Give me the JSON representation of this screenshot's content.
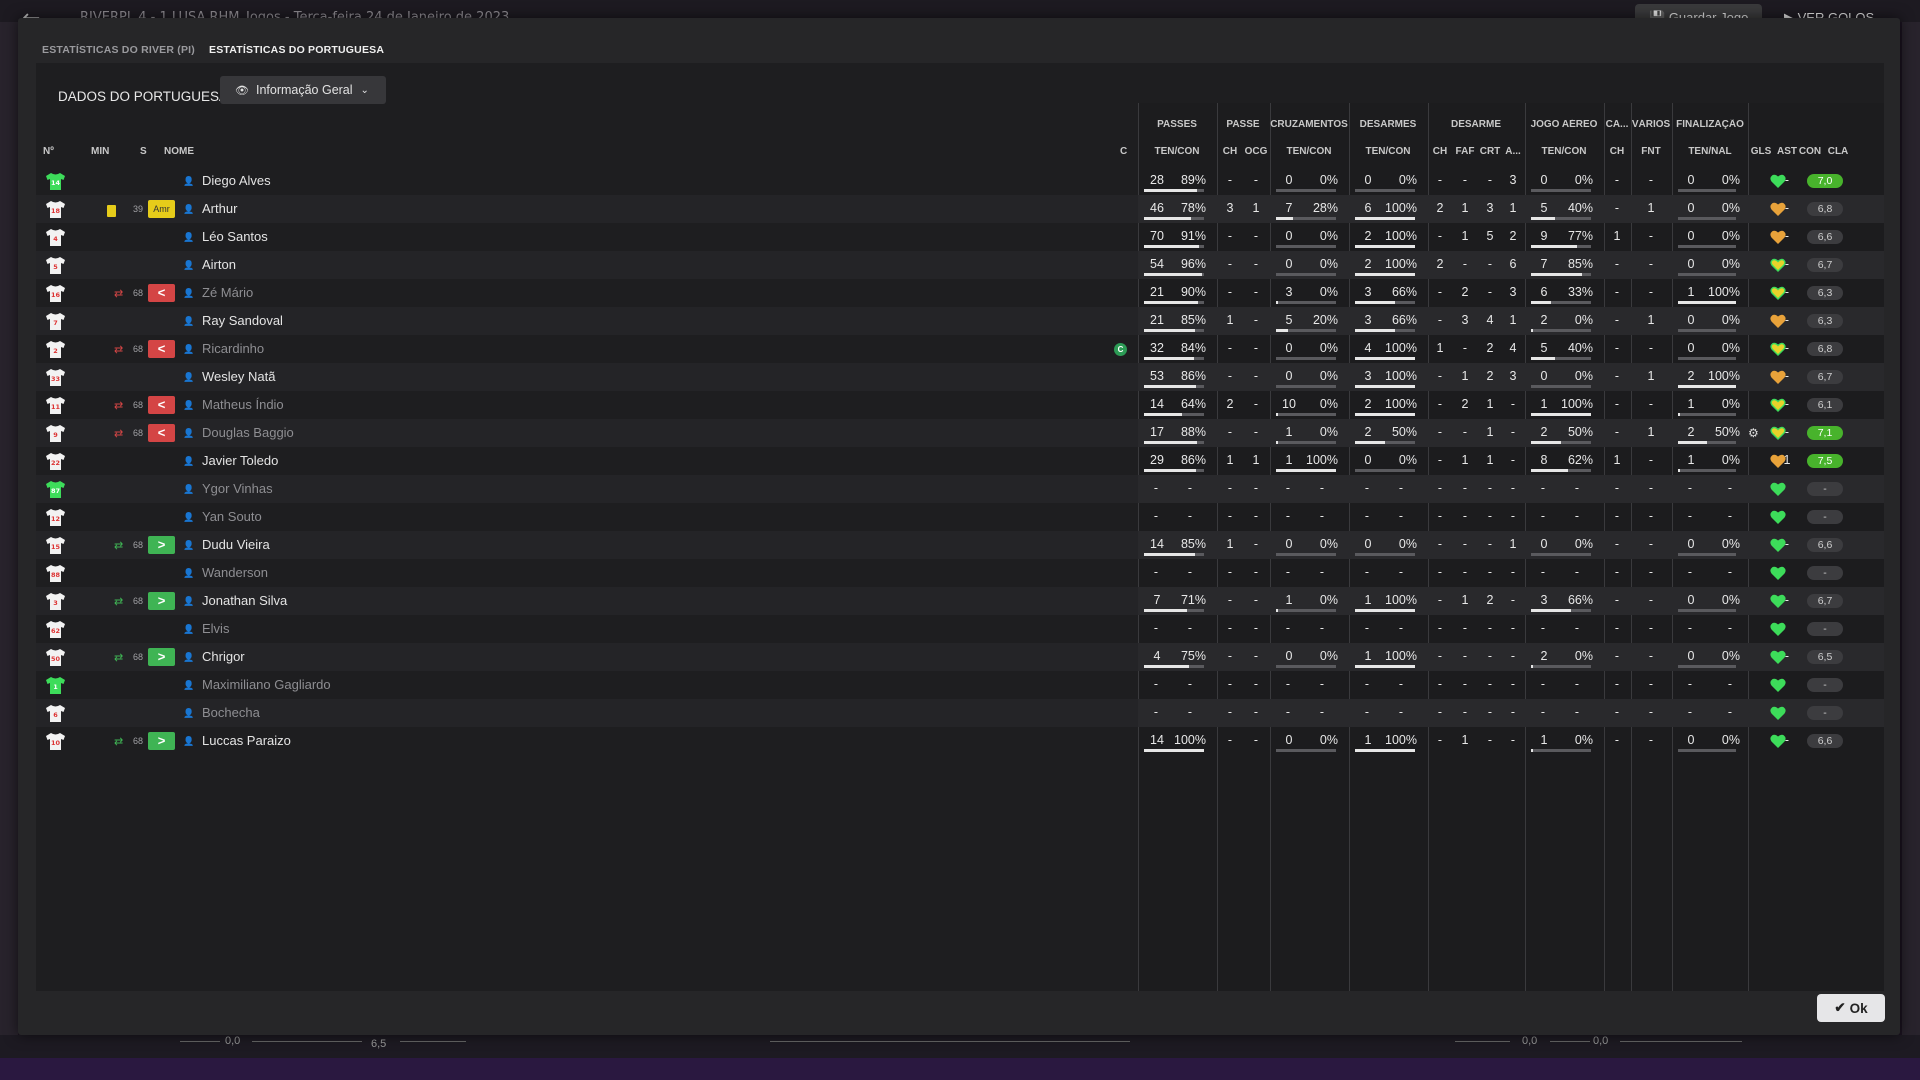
{
  "background": {
    "header_text": "RIVERPL  4 - 1  LUSA   RHM_Jogos  -  Terça-feira 24 de Janeiro de 2023",
    "save_button": "Guardar Jogo",
    "goals_button": "VER GOLOS",
    "bottom_value": "6,5",
    "bottom_left_value": "0,0",
    "bottom_right_value_1": "0,0",
    "bottom_right_value_2": "0,0"
  },
  "tabs": [
    "ESTATÍSTICAS DO RIVER (PI)",
    "ESTATÍSTICAS DO PORTUGUESA"
  ],
  "active_tab": 1,
  "panel_title": "DADOS DO PORTUGUESA",
  "view_select": "Informação Geral",
  "groups": {
    "passes": "PASSES",
    "passe": "PASSE",
    "cruzamentos": "CRUZAMENTOS",
    "desarmes": "DESARMES",
    "desarme": "DESARME",
    "jogo_aereo": "JOGO AÉREO",
    "ca": "CA...",
    "varios": "VÁRIOS",
    "finalizacao": "FINALIZAÇÃO"
  },
  "columns": {
    "no": "Nº",
    "min": "MIN",
    "s": "S",
    "nome": "NOME",
    "c": "C",
    "passes_tc": "TEN/CON",
    "passe_ch": "CH",
    "passe_ocg": "OCG",
    "cruz_tc": "TEN/CON",
    "des_tc": "TEN/CON",
    "d_ch": "CH",
    "d_faf": "FAF",
    "d_crt": "CRT",
    "d_a": "A...",
    "ja_tc": "TEN/CON",
    "ca_ch": "CH",
    "var_fnt": "FNT",
    "fin_tn": "TEN/NAL",
    "gls": "GLS",
    "ast": "AST",
    "con": "CON",
    "cla": "CLA"
  },
  "colors": {
    "heart_green": "#3ddc5a",
    "heart_yellow": "#e8d22a",
    "heart_orange": "#e8a23a",
    "rating_high": "#48b32c",
    "sub_out": "#d44545",
    "sub_in": "#3fb454",
    "yellow_card": "#e6cc1a"
  },
  "players": [
    {
      "no": "14",
      "shirt": "gk",
      "min": "",
      "s": "",
      "card": false,
      "name": "Diego Alves",
      "active": true,
      "cap": false,
      "p": [
        "28",
        "89%"
      ],
      "pch": "-",
      "pocg": "-",
      "cz": [
        "0",
        "0%"
      ],
      "ds": [
        "0",
        "0%"
      ],
      "dch": "-",
      "dfaf": "-",
      "dcrt": "-",
      "da": "3",
      "ja": [
        "0",
        "0%"
      ],
      "cach": "-",
      "fnt": "-",
      "fin": [
        "0",
        "0%"
      ],
      "gls": "",
      "gear": false,
      "ast": "-",
      "heart": "green",
      "cla": "7,0",
      "hi": true
    },
    {
      "no": "18",
      "shirt": "w",
      "min": "39",
      "s": "Amr",
      "sclass": "amr",
      "card": true,
      "name": "Arthur",
      "active": true,
      "cap": false,
      "p": [
        "46",
        "78%"
      ],
      "pch": "3",
      "pocg": "1",
      "cz": [
        "7",
        "28%"
      ],
      "ds": [
        "6",
        "100%"
      ],
      "dch": "2",
      "dfaf": "1",
      "dcrt": "3",
      "da": "1",
      "ja": [
        "5",
        "40%"
      ],
      "cach": "-",
      "fnt": "1",
      "fin": [
        "0",
        "0%"
      ],
      "gls": "",
      "gear": false,
      "ast": "-",
      "heart": "orange",
      "cla": "6,8",
      "hi": false
    },
    {
      "no": "4",
      "shirt": "w",
      "min": "",
      "s": "",
      "card": false,
      "name": "Léo Santos",
      "active": true,
      "cap": false,
      "p": [
        "70",
        "91%"
      ],
      "pch": "-",
      "pocg": "-",
      "cz": [
        "0",
        "0%"
      ],
      "ds": [
        "2",
        "100%"
      ],
      "dch": "-",
      "dfaf": "1",
      "dcrt": "5",
      "da": "2",
      "ja": [
        "9",
        "77%"
      ],
      "cach": "1",
      "fnt": "-",
      "fin": [
        "0",
        "0%"
      ],
      "gls": "",
      "gear": false,
      "ast": "-",
      "heart": "orange",
      "cla": "6,6",
      "hi": false
    },
    {
      "no": "5",
      "shirt": "w",
      "min": "",
      "s": "",
      "card": false,
      "name": "Airton",
      "active": true,
      "cap": false,
      "p": [
        "54",
        "96%"
      ],
      "pch": "-",
      "pocg": "-",
      "cz": [
        "0",
        "0%"
      ],
      "ds": [
        "2",
        "100%"
      ],
      "dch": "2",
      "dfaf": "-",
      "dcrt": "-",
      "da": "6",
      "ja": [
        "7",
        "85%"
      ],
      "cach": "-",
      "fnt": "-",
      "fin": [
        "0",
        "0%"
      ],
      "gls": "",
      "gear": false,
      "ast": "-",
      "heart": "yellow",
      "cla": "6,7",
      "hi": false
    },
    {
      "no": "16",
      "shirt": "w",
      "min": "68",
      "s": "<",
      "sclass": "red",
      "sub": "out",
      "card": false,
      "name": "Zé Mário",
      "active": false,
      "cap": false,
      "p": [
        "21",
        "90%"
      ],
      "pch": "-",
      "pocg": "-",
      "cz": [
        "3",
        "0%"
      ],
      "ds": [
        "3",
        "66%"
      ],
      "dch": "-",
      "dfaf": "2",
      "dcrt": "-",
      "da": "3",
      "ja": [
        "6",
        "33%"
      ],
      "cach": "-",
      "fnt": "-",
      "fin": [
        "1",
        "100%"
      ],
      "gls": "",
      "gear": false,
      "ast": "-",
      "heart": "yellow",
      "cla": "6,3",
      "hi": false
    },
    {
      "no": "7",
      "shirt": "w",
      "min": "",
      "s": "",
      "card": false,
      "name": "Ray Sandoval",
      "active": true,
      "cap": false,
      "p": [
        "21",
        "85%"
      ],
      "pch": "1",
      "pocg": "-",
      "cz": [
        "5",
        "20%"
      ],
      "ds": [
        "3",
        "66%"
      ],
      "dch": "-",
      "dfaf": "3",
      "dcrt": "4",
      "da": "1",
      "ja": [
        "2",
        "0%"
      ],
      "cach": "-",
      "fnt": "1",
      "fin": [
        "0",
        "0%"
      ],
      "gls": "",
      "gear": false,
      "ast": "-",
      "heart": "orange",
      "cla": "6,3",
      "hi": false
    },
    {
      "no": "2",
      "shirt": "w",
      "min": "68",
      "s": "<",
      "sclass": "red",
      "sub": "out",
      "card": false,
      "name": "Ricardinho",
      "active": false,
      "cap": true,
      "p": [
        "32",
        "84%"
      ],
      "pch": "-",
      "pocg": "-",
      "cz": [
        "0",
        "0%"
      ],
      "ds": [
        "4",
        "100%"
      ],
      "dch": "1",
      "dfaf": "-",
      "dcrt": "2",
      "da": "4",
      "ja": [
        "5",
        "40%"
      ],
      "cach": "-",
      "fnt": "-",
      "fin": [
        "0",
        "0%"
      ],
      "gls": "",
      "gear": false,
      "ast": "-",
      "heart": "yellow",
      "cla": "6,8",
      "hi": false
    },
    {
      "no": "33",
      "shirt": "w",
      "min": "",
      "s": "",
      "card": false,
      "name": "Wesley Natã",
      "active": true,
      "cap": false,
      "p": [
        "53",
        "86%"
      ],
      "pch": "-",
      "pocg": "-",
      "cz": [
        "0",
        "0%"
      ],
      "ds": [
        "3",
        "100%"
      ],
      "dch": "-",
      "dfaf": "1",
      "dcrt": "2",
      "da": "3",
      "ja": [
        "0",
        "0%"
      ],
      "cach": "-",
      "fnt": "1",
      "fin": [
        "2",
        "100%"
      ],
      "gls": "",
      "gear": false,
      "ast": "-",
      "heart": "orange",
      "cla": "6,7",
      "hi": false
    },
    {
      "no": "11",
      "shirt": "w",
      "min": "68",
      "s": "<",
      "sclass": "red",
      "sub": "out",
      "card": false,
      "name": "Matheus Índio",
      "active": false,
      "cap": false,
      "p": [
        "14",
        "64%"
      ],
      "pch": "2",
      "pocg": "-",
      "cz": [
        "10",
        "0%"
      ],
      "ds": [
        "2",
        "100%"
      ],
      "dch": "-",
      "dfaf": "2",
      "dcrt": "1",
      "da": "-",
      "ja": [
        "1",
        "100%"
      ],
      "cach": "-",
      "fnt": "-",
      "fin": [
        "1",
        "0%"
      ],
      "gls": "",
      "gear": false,
      "ast": "-",
      "heart": "yellow",
      "cla": "6,1",
      "hi": false
    },
    {
      "no": "9",
      "shirt": "w",
      "min": "68",
      "s": "<",
      "sclass": "red",
      "sub": "out",
      "card": false,
      "name": "Douglas Baggio",
      "active": false,
      "cap": false,
      "p": [
        "17",
        "88%"
      ],
      "pch": "-",
      "pocg": "-",
      "cz": [
        "1",
        "0%"
      ],
      "ds": [
        "2",
        "50%"
      ],
      "dch": "-",
      "dfaf": "-",
      "dcrt": "1",
      "da": "-",
      "ja": [
        "2",
        "50%"
      ],
      "cach": "-",
      "fnt": "1",
      "fin": [
        "2",
        "50%"
      ],
      "gls": "",
      "gear": true,
      "ast": "-",
      "heart": "yellow",
      "cla": "7,1",
      "hi": true
    },
    {
      "no": "22",
      "shirt": "w",
      "min": "",
      "s": "",
      "card": false,
      "name": "Javier Toledo",
      "active": true,
      "cap": false,
      "p": [
        "29",
        "86%"
      ],
      "pch": "1",
      "pocg": "1",
      "cz": [
        "1",
        "100%"
      ],
      "ds": [
        "0",
        "0%"
      ],
      "dch": "-",
      "dfaf": "1",
      "dcrt": "1",
      "da": "-",
      "ja": [
        "8",
        "62%"
      ],
      "cach": "1",
      "fnt": "-",
      "fin": [
        "1",
        "0%"
      ],
      "gls": "",
      "gear": false,
      "ast": "1",
      "heart": "orange",
      "cla": "7,5",
      "hi": true
    },
    {
      "no": "87",
      "shirt": "gk",
      "min": "",
      "s": "",
      "card": false,
      "name": "Ygor Vinhas",
      "active": false,
      "cap": false,
      "empty": true,
      "heart": "green",
      "cla": "-",
      "hi": false
    },
    {
      "no": "12",
      "shirt": "w",
      "min": "",
      "s": "",
      "card": false,
      "name": "Yan Souto",
      "active": false,
      "cap": false,
      "empty": true,
      "heart": "green",
      "cla": "-",
      "hi": false
    },
    {
      "no": "15",
      "shirt": "w",
      "min": "68",
      "s": ">",
      "sclass": "green",
      "sub": "in",
      "card": false,
      "name": "Dudu Vieira",
      "active": true,
      "cap": false,
      "p": [
        "14",
        "85%"
      ],
      "pch": "1",
      "pocg": "-",
      "cz": [
        "0",
        "0%"
      ],
      "ds": [
        "0",
        "0%"
      ],
      "dch": "-",
      "dfaf": "-",
      "dcrt": "-",
      "da": "1",
      "ja": [
        "0",
        "0%"
      ],
      "cach": "-",
      "fnt": "-",
      "fin": [
        "0",
        "0%"
      ],
      "gls": "",
      "gear": false,
      "ast": "-",
      "heart": "green",
      "cla": "6,6",
      "hi": false
    },
    {
      "no": "88",
      "shirt": "w",
      "min": "",
      "s": "",
      "card": false,
      "name": "Wanderson",
      "active": false,
      "cap": false,
      "empty": true,
      "heart": "green",
      "cla": "-",
      "hi": false
    },
    {
      "no": "3",
      "shirt": "w",
      "min": "68",
      "s": ">",
      "sclass": "green",
      "sub": "in",
      "card": false,
      "name": "Jonathan Silva",
      "active": true,
      "cap": false,
      "p": [
        "7",
        "71%"
      ],
      "pch": "-",
      "pocg": "-",
      "cz": [
        "1",
        "0%"
      ],
      "ds": [
        "1",
        "100%"
      ],
      "dch": "-",
      "dfaf": "1",
      "dcrt": "2",
      "da": "-",
      "ja": [
        "3",
        "66%"
      ],
      "cach": "-",
      "fnt": "-",
      "fin": [
        "0",
        "0%"
      ],
      "gls": "",
      "gear": false,
      "ast": "-",
      "heart": "green",
      "cla": "6,7",
      "hi": false
    },
    {
      "no": "62",
      "shirt": "w",
      "min": "",
      "s": "",
      "card": false,
      "name": "Elvis",
      "active": false,
      "cap": false,
      "empty": true,
      "heart": "green",
      "cla": "-",
      "hi": false
    },
    {
      "no": "50",
      "shirt": "w",
      "min": "68",
      "s": ">",
      "sclass": "green",
      "sub": "in",
      "card": false,
      "name": "Chrigor",
      "active": true,
      "cap": false,
      "p": [
        "4",
        "75%"
      ],
      "pch": "-",
      "pocg": "-",
      "cz": [
        "0",
        "0%"
      ],
      "ds": [
        "1",
        "100%"
      ],
      "dch": "-",
      "dfaf": "-",
      "dcrt": "-",
      "da": "-",
      "ja": [
        "2",
        "0%"
      ],
      "cach": "-",
      "fnt": "-",
      "fin": [
        "0",
        "0%"
      ],
      "gls": "",
      "gear": false,
      "ast": "-",
      "heart": "green",
      "cla": "6,5",
      "hi": false
    },
    {
      "no": "1",
      "shirt": "gk",
      "min": "",
      "s": "",
      "card": false,
      "name": "Maximiliano Gagliardo",
      "active": false,
      "cap": false,
      "empty": true,
      "heart": "green",
      "cla": "-",
      "hi": false
    },
    {
      "no": "6",
      "shirt": "w",
      "min": "",
      "s": "",
      "card": false,
      "name": "Bochecha",
      "active": false,
      "cap": false,
      "empty": true,
      "heart": "green",
      "cla": "-",
      "hi": false
    },
    {
      "no": "10",
      "shirt": "w",
      "min": "68",
      "s": ">",
      "sclass": "green",
      "sub": "in",
      "card": false,
      "name": "Luccas Paraizo",
      "active": true,
      "cap": false,
      "p": [
        "14",
        "100%"
      ],
      "pch": "-",
      "pocg": "-",
      "cz": [
        "0",
        "0%"
      ],
      "ds": [
        "1",
        "100%"
      ],
      "dch": "-",
      "dfaf": "1",
      "dcrt": "-",
      "da": "-",
      "ja": [
        "1",
        "0%"
      ],
      "cach": "-",
      "fnt": "-",
      "fin": [
        "0",
        "0%"
      ],
      "gls": "",
      "gear": false,
      "ast": "-",
      "heart": "green",
      "cla": "6,6",
      "hi": false
    }
  ],
  "ok_button": "Ok"
}
